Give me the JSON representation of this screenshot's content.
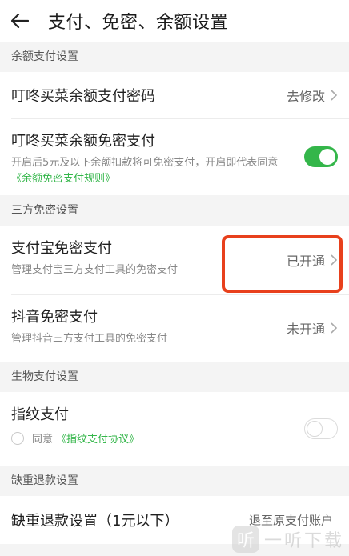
{
  "header": {
    "title": "支付、免密、余额设置"
  },
  "sections": {
    "balance": {
      "title": "余额支付设置",
      "password": {
        "label": "叮咚买菜余额支付密码",
        "action": "去修改"
      },
      "nopwd": {
        "label": "叮咚买菜余额免密支付",
        "desc": "开启后5元及以下余额扣款将可免密支付，开启即代表同意",
        "link": "《余额免密支付规则》",
        "enabled": true
      }
    },
    "third": {
      "title": "三方免密设置",
      "alipay": {
        "label": "支付宝免密支付",
        "desc": "管理支付宝三方支付工具的免密支付",
        "status": "已开通"
      },
      "douyin": {
        "label": "抖音免密支付",
        "desc": "管理抖音三方支付工具的免密支付",
        "status": "未开通"
      }
    },
    "bio": {
      "title": "生物支付设置",
      "fingerprint": {
        "label": "指纹支付",
        "agree_text": "同意",
        "agree_link": "《指纹支付协议》",
        "enabled": false
      }
    },
    "refund": {
      "title": "缺重退款设置",
      "item": {
        "label": "缺重退款设置（1元以下）",
        "value": "退至原支付账户"
      }
    }
  },
  "watermark": {
    "logo_char": "听",
    "text": "一听下载"
  },
  "colors": {
    "accent": "#34b64a",
    "highlight": "#e8401c"
  }
}
